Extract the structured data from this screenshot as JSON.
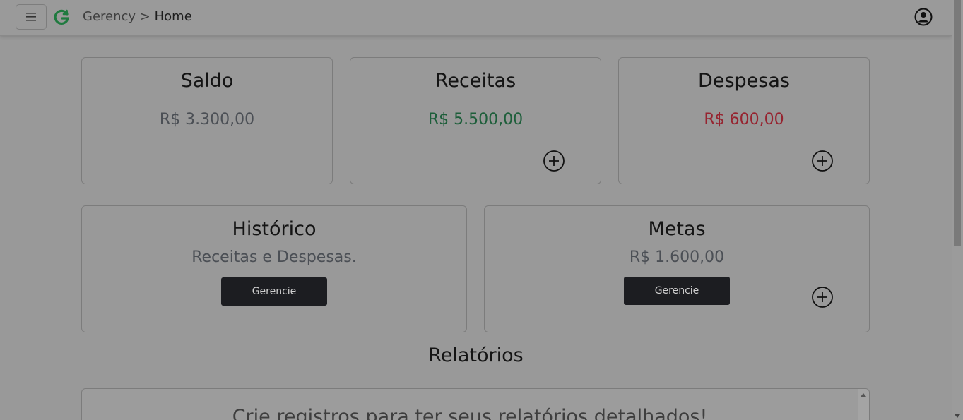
{
  "navbar": {
    "menu_icon": "hamburger-icon",
    "logo_icon": "gerency-logo-icon",
    "breadcrumb_root": "Gerency",
    "breadcrumb_sep": ">",
    "breadcrumb_current": "Home",
    "user_icon": "user-circle-icon"
  },
  "cards": {
    "saldo": {
      "title": "Saldo",
      "value": "R$ 3.300,00"
    },
    "receitas": {
      "title": "Receitas",
      "value": "R$ 5.500,00"
    },
    "despesas": {
      "title": "Despesas",
      "value": "R$ 600,00"
    },
    "historico": {
      "title": "Histórico",
      "subtitle": "Receitas e Despesas.",
      "button": "Gerencie"
    },
    "metas": {
      "title": "Metas",
      "value": "R$ 1.600,00",
      "button": "Gerencie"
    }
  },
  "reports": {
    "title": "Relatórios",
    "empty_message": "Crie registros para ter seus relatórios detalhados!"
  },
  "colors": {
    "neutral_value": "#4b4f55",
    "income_value": "#1d5e3a",
    "expense_value": "#962430",
    "button_dark": "#1c1d21",
    "logo_green": "#1f7a3f"
  }
}
